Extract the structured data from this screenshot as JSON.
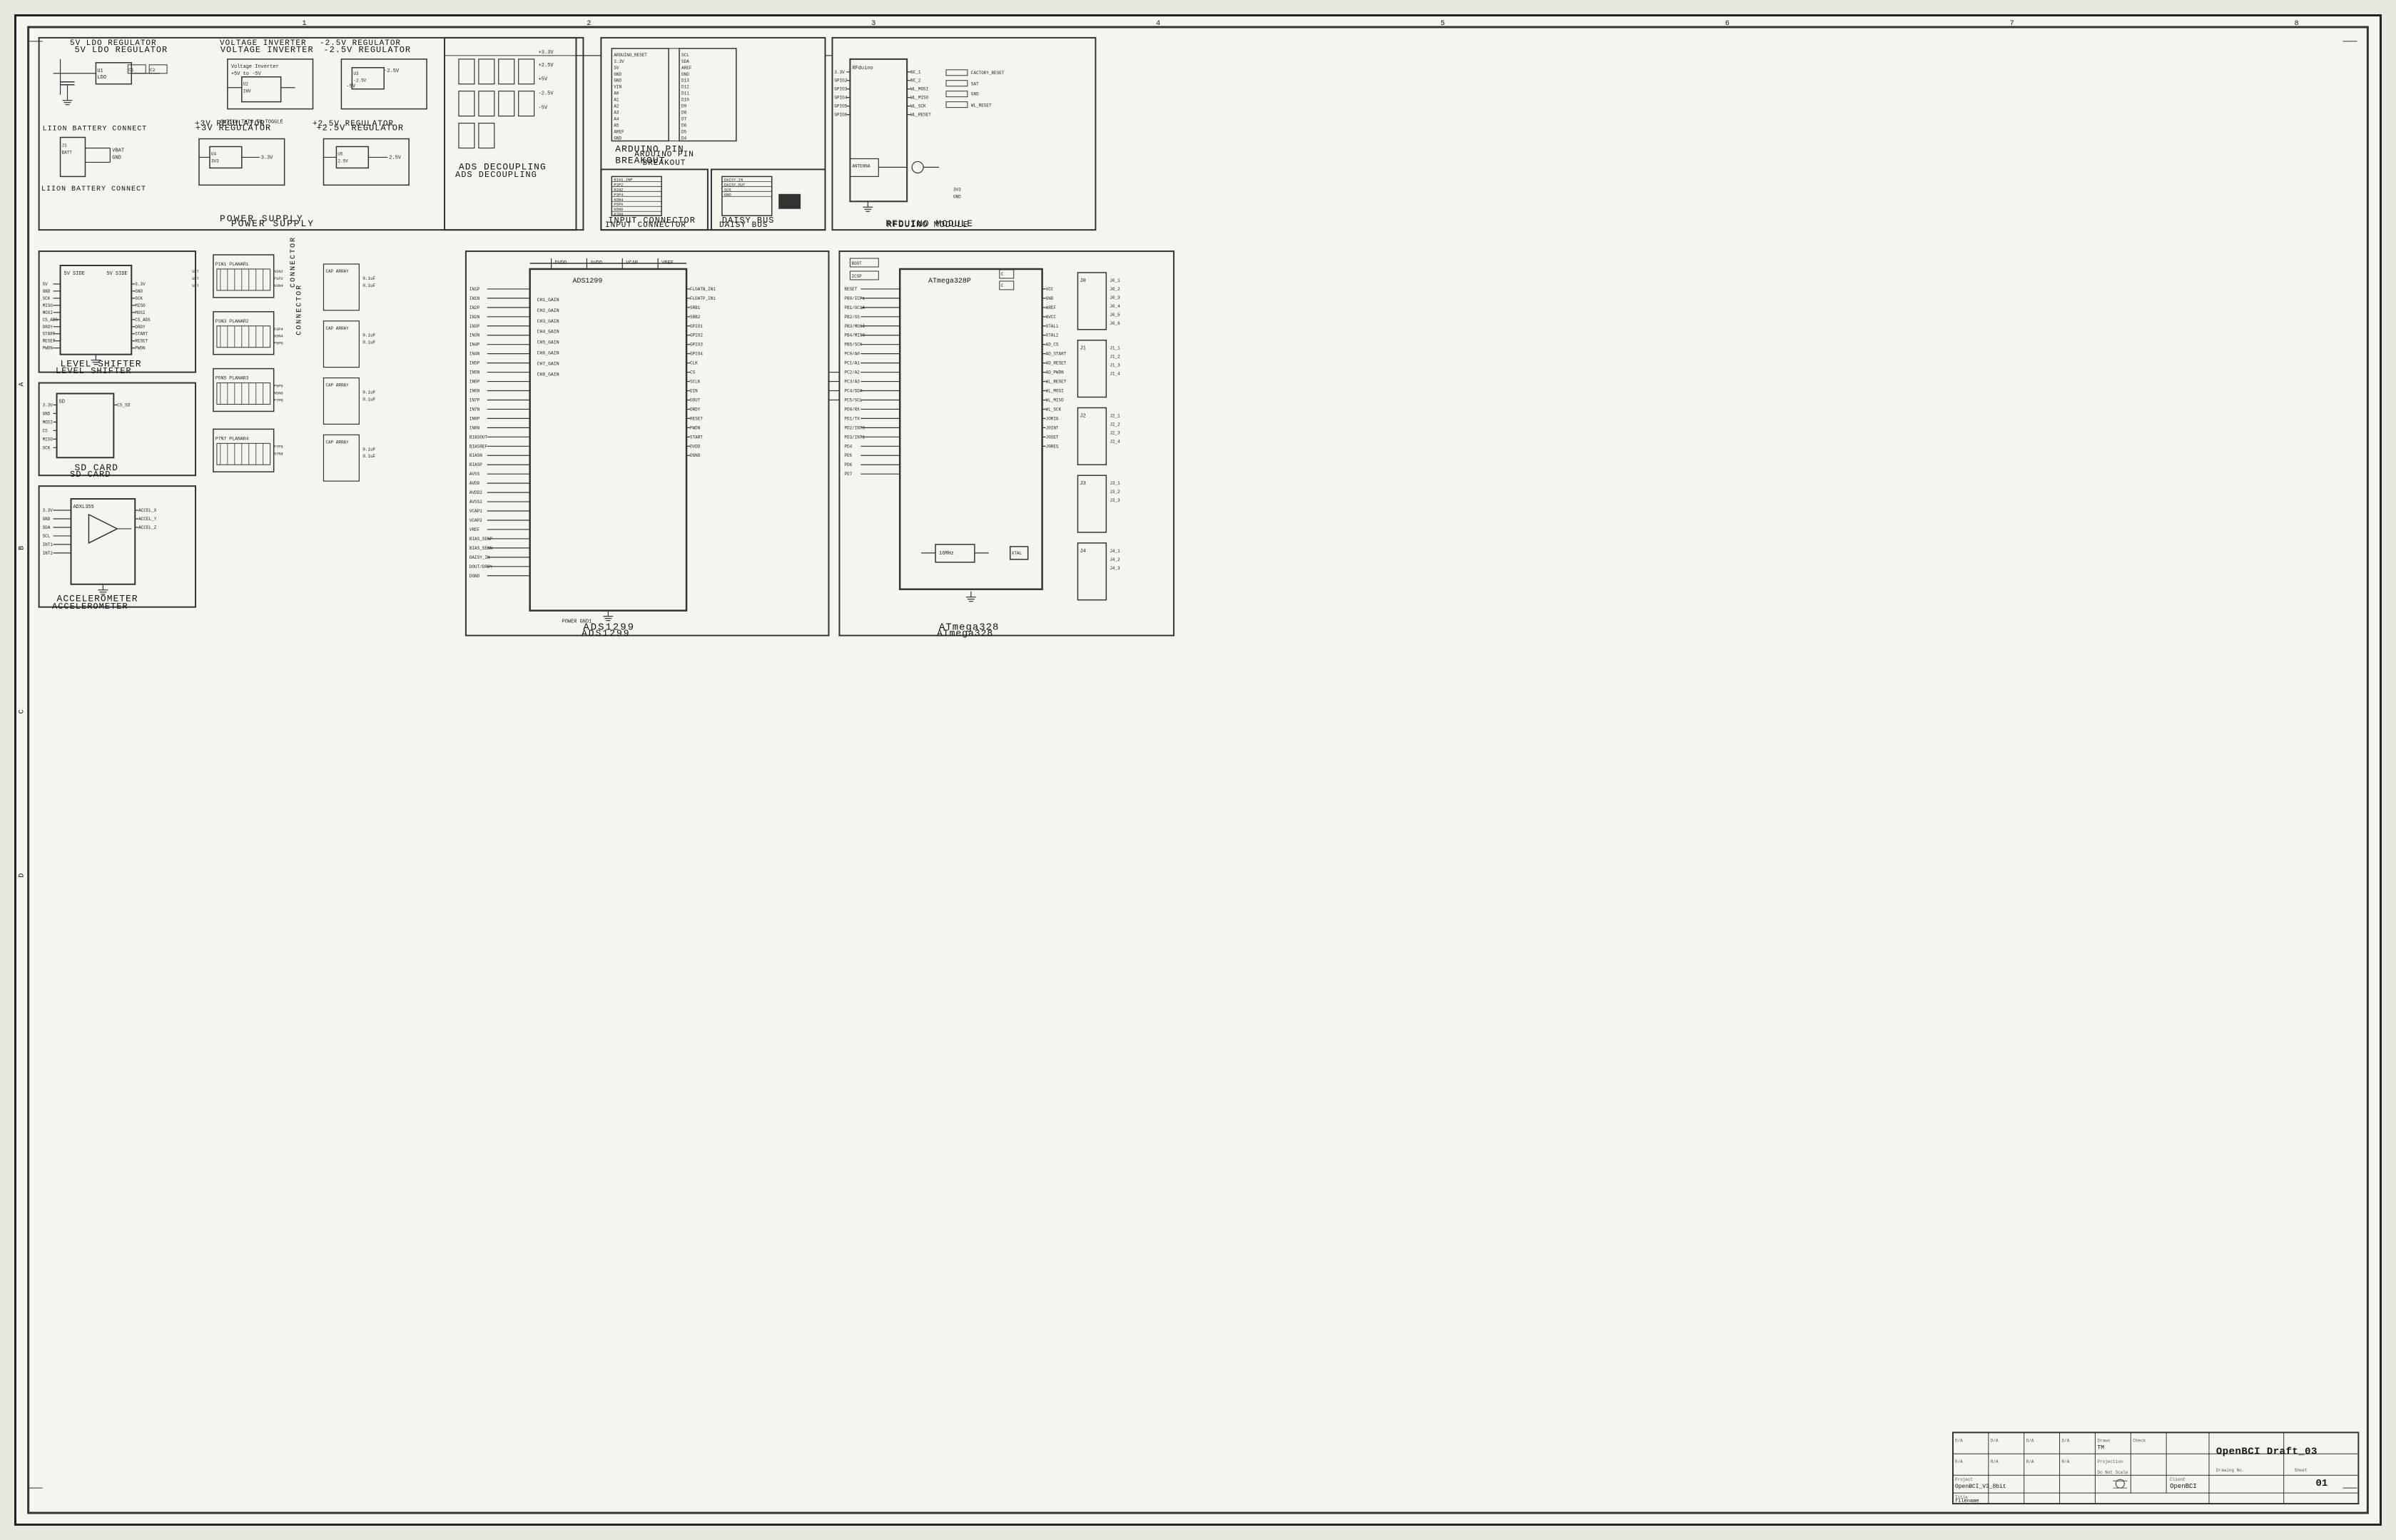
{
  "sheet": {
    "title": "OpenBCI Draft_03",
    "project": "OpenBCI_V3_8bit",
    "client": "OpenBCI",
    "filename": "filename",
    "sheet": "01",
    "drawing_no": "",
    "scale": "Do Not Scale",
    "projection": "",
    "drawn": "TM",
    "checked": "",
    "date1": "D/A",
    "date2": "D/A",
    "date3": "D/A",
    "date4": "D/A",
    "rev1": "R/A",
    "rev2": "R/A",
    "rev3": "R/A",
    "rev4": "R/A"
  },
  "sections": {
    "power_supply": {
      "label": "POWER SUPPLY",
      "sub_sections": [
        "5V LDO REGULATOR",
        "VOLTAGE INVERTER",
        "-2.5V REGULATOR",
        "+3V REGULATOR",
        "+2.5V REGULATOR",
        "ADS DECOUPLING",
        "LIION BATTERY CONNECT"
      ]
    },
    "arduino_pin_breakout": {
      "label": "ARDUINO PIN BREAKOUT"
    },
    "input_connector": {
      "label": "INPUT CONNECTOR"
    },
    "daisy_bus": {
      "label": "DAISY BUS"
    },
    "rfduino_module": {
      "label": "RFDUINO MODULE"
    },
    "level_shifter": {
      "label": "LEVEL SHIFTER"
    },
    "sd_card": {
      "label": "SD CARD"
    },
    "accelerometer": {
      "label": "ACCELEROMETER"
    },
    "ads1299": {
      "label": "ADS1299"
    },
    "atmega328": {
      "label": "ATmega328"
    },
    "connector": {
      "label": "CONNECTOR"
    }
  },
  "colors": {
    "background": "#f5f5ef",
    "border": "#333333",
    "text": "#111111",
    "line": "#333333",
    "page_bg": "#e8e8e0"
  }
}
